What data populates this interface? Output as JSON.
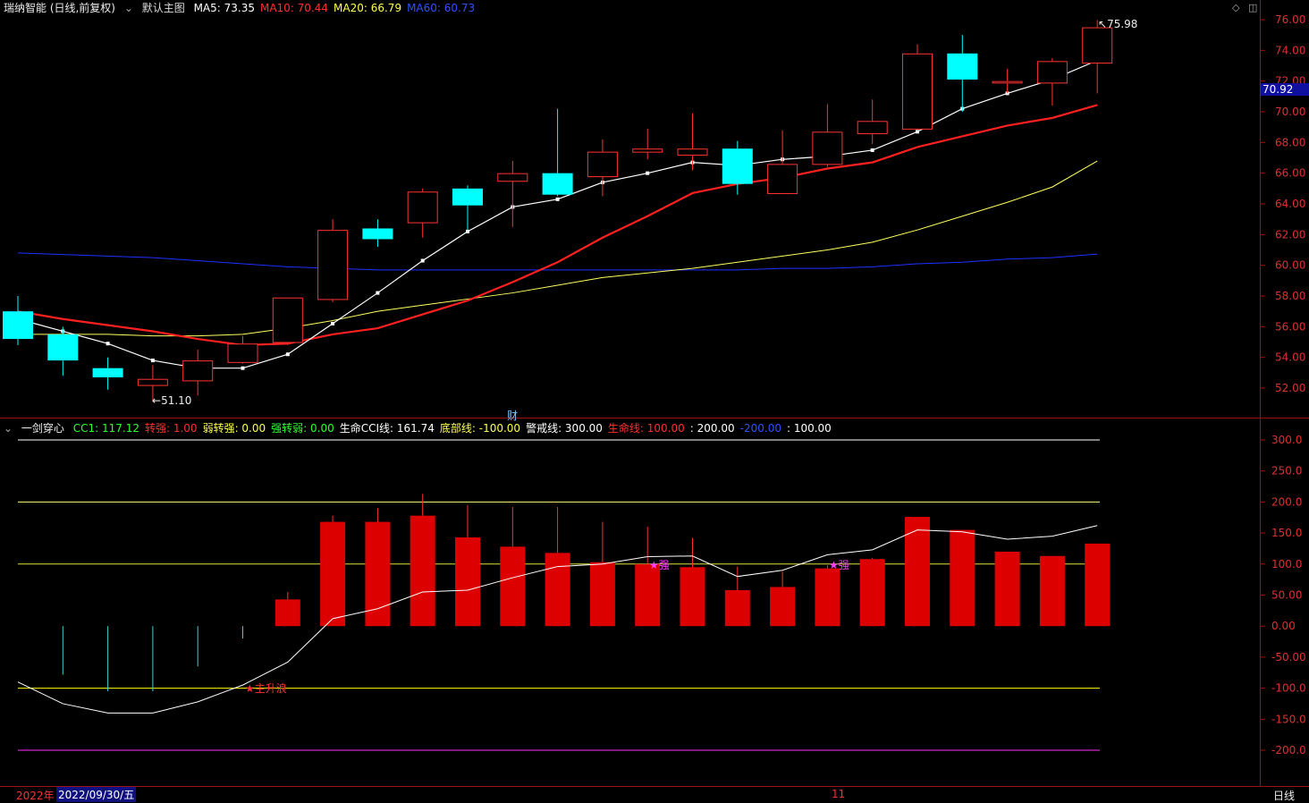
{
  "header": {
    "stock_name": "瑞纳智能 (日线,前复权)",
    "main_chart_label": "默认主图",
    "ma_labels": [
      {
        "text": "MA5: 73.35",
        "color": "#ffffff"
      },
      {
        "text": "MA10: 70.44",
        "color": "#ff3030"
      },
      {
        "text": "MA20: 66.79",
        "color": "#ffff50"
      },
      {
        "text": "MA60: 60.73",
        "color": "#3050ff"
      }
    ]
  },
  "indicator_header": {
    "name": "一剑穿心",
    "items": [
      {
        "text": "CC1: 117.12",
        "color": "#30ff30"
      },
      {
        "text": "转强: 1.00",
        "color": "#ff3030"
      },
      {
        "text": "弱转强: 0.00",
        "color": "#ffff50"
      },
      {
        "text": "强转弱: 0.00",
        "color": "#30ff30"
      },
      {
        "text": "生命CCI线: 161.74",
        "color": "#ffffff"
      },
      {
        "text": "底部线: -100.00",
        "color": "#ffff50"
      },
      {
        "text": "警戒线: 300.00",
        "color": "#ffffff"
      },
      {
        "text": "生命线: 100.00",
        "color": "#ff3030"
      },
      {
        "text": ": 200.00",
        "color": "#ffffff"
      },
      {
        "text": "-200.00",
        "color": "#3050ff"
      },
      {
        "text": ": 100.00",
        "color": "#ffffff"
      }
    ]
  },
  "current_price_label": "70.92",
  "markers": {
    "high": "75.98",
    "low": "51.10",
    "finance": "财",
    "signal_main": "主升浪",
    "signal_strong_1": "强",
    "signal_strong_2": "强"
  },
  "footer": {
    "year": "2022年",
    "date": "2022/09/30/五",
    "month": "11",
    "period": "日线"
  },
  "colors": {
    "up": "#ff3232",
    "down": "#00ffff",
    "ma5": "#ffffff",
    "ma10": "#ff2020",
    "ma20": "#ffff60",
    "ma60": "#2030ff",
    "bar": "#dd0000",
    "axis": "#a01010"
  },
  "chart_data": [
    {
      "type": "candlestick",
      "title": "瑞纳智能 (日线,前复权)",
      "ylim": [
        50.5,
        76.8
      ],
      "yticks": [
        52,
        54,
        56,
        58,
        60,
        62,
        64,
        66,
        68,
        70,
        72,
        74,
        76
      ],
      "ytick_labels": [
        "52.00",
        "54.00",
        "56.00",
        "58.00",
        "60.00",
        "62.00",
        "64.00",
        "66.00",
        "68.00",
        "70.00",
        "72.00",
        "74.00",
        "76.00"
      ],
      "candles": [
        {
          "o": 57.0,
          "h": 58.0,
          "l": 54.8,
          "c": 55.2
        },
        {
          "o": 55.5,
          "h": 56.0,
          "l": 52.8,
          "c": 53.8
        },
        {
          "o": 53.3,
          "h": 54.0,
          "l": 51.9,
          "c": 52.7
        },
        {
          "o": 52.2,
          "h": 53.5,
          "l": 51.1,
          "c": 52.6
        },
        {
          "o": 52.5,
          "h": 54.5,
          "l": 51.5,
          "c": 53.8
        },
        {
          "o": 53.7,
          "h": 55.4,
          "l": 53.6,
          "c": 54.9
        },
        {
          "o": 55.0,
          "h": 57.9,
          "l": 54.8,
          "c": 57.9
        },
        {
          "o": 57.8,
          "h": 63.0,
          "l": 57.6,
          "c": 62.3
        },
        {
          "o": 62.4,
          "h": 63.0,
          "l": 61.2,
          "c": 61.7
        },
        {
          "o": 62.8,
          "h": 65.0,
          "l": 61.8,
          "c": 64.8
        },
        {
          "o": 65.0,
          "h": 65.2,
          "l": 62.3,
          "c": 63.9
        },
        {
          "o": 65.5,
          "h": 66.8,
          "l": 62.5,
          "c": 66.0
        },
        {
          "o": 66.0,
          "h": 70.2,
          "l": 64.5,
          "c": 64.6
        },
        {
          "o": 65.8,
          "h": 68.2,
          "l": 64.5,
          "c": 67.4
        },
        {
          "o": 67.4,
          "h": 68.9,
          "l": 66.9,
          "c": 67.6
        },
        {
          "o": 67.2,
          "h": 69.9,
          "l": 66.2,
          "c": 67.6
        },
        {
          "o": 67.6,
          "h": 68.1,
          "l": 64.6,
          "c": 65.3
        },
        {
          "o": 64.7,
          "h": 68.8,
          "l": 64.7,
          "c": 66.6
        },
        {
          "o": 66.6,
          "h": 70.5,
          "l": 66.4,
          "c": 68.7
        },
        {
          "o": 68.6,
          "h": 70.8,
          "l": 67.9,
          "c": 69.4
        },
        {
          "o": 68.9,
          "h": 74.4,
          "l": 68.8,
          "c": 73.8
        },
        {
          "o": 73.8,
          "h": 75.0,
          "l": 70.0,
          "c": 72.1
        },
        {
          "o": 71.9,
          "h": 72.8,
          "l": 71.2,
          "c": 72.0
        },
        {
          "o": 71.9,
          "h": 73.5,
          "l": 70.4,
          "c": 73.3
        },
        {
          "o": 73.2,
          "h": 75.98,
          "l": 71.2,
          "c": 75.5
        }
      ],
      "ma5": [
        56.5,
        55.7,
        54.9,
        53.8,
        53.3,
        53.3,
        54.2,
        56.2,
        58.2,
        60.3,
        62.2,
        63.8,
        64.3,
        65.4,
        66.0,
        66.7,
        66.5,
        66.9,
        67.1,
        67.5,
        68.7,
        70.2,
        71.2,
        72.1,
        73.35
      ],
      "ma10": [
        57.0,
        56.5,
        56.1,
        55.7,
        55.2,
        54.8,
        54.9,
        55.5,
        55.9,
        56.8,
        57.7,
        58.9,
        60.2,
        61.8,
        63.2,
        64.7,
        65.3,
        65.7,
        66.3,
        66.7,
        67.7,
        68.4,
        69.1,
        69.6,
        70.44
      ],
      "ma20": [
        55.5,
        55.5,
        55.5,
        55.4,
        55.4,
        55.5,
        55.9,
        56.4,
        57.0,
        57.4,
        57.8,
        58.2,
        58.7,
        59.2,
        59.5,
        59.8,
        60.2,
        60.6,
        61.0,
        61.5,
        62.3,
        63.2,
        64.1,
        65.1,
        66.79
      ],
      "ma60": [
        60.8,
        60.7,
        60.6,
        60.5,
        60.3,
        60.1,
        59.9,
        59.8,
        59.7,
        59.7,
        59.7,
        59.7,
        59.7,
        59.7,
        59.7,
        59.7,
        59.7,
        59.8,
        59.8,
        59.9,
        60.1,
        60.2,
        60.4,
        60.5,
        60.73
      ]
    },
    {
      "type": "bar",
      "title": "一剑穿心",
      "ylim": [
        -225,
        330
      ],
      "yticks": [
        -200,
        -150,
        -100,
        -50,
        0,
        50,
        100,
        150,
        200,
        250,
        300
      ],
      "ytick_labels": [
        "-200.0",
        "-150.0",
        "-100.0",
        "-50.00",
        "0.00",
        "50.00",
        "100.0",
        "150.0",
        "200.0",
        "250.0",
        "300.0"
      ],
      "bars": [
        {
          "v": 0,
          "top": 0
        },
        {
          "v": -78,
          "top": 0
        },
        {
          "v": -105,
          "top": 0
        },
        {
          "v": -105,
          "top": 0
        },
        {
          "v": -65,
          "top": 0
        },
        {
          "v": -20,
          "top": 0
        },
        {
          "v": 43,
          "top": 55
        },
        {
          "v": 168,
          "top": 178
        },
        {
          "v": 168,
          "top": 190
        },
        {
          "v": 178,
          "top": 213
        },
        {
          "v": 143,
          "top": 195
        },
        {
          "v": 128,
          "top": 192
        },
        {
          "v": 118,
          "top": 192
        },
        {
          "v": 103,
          "top": 168
        },
        {
          "v": 100,
          "top": 160
        },
        {
          "v": 95,
          "top": 142
        },
        {
          "v": 58,
          "top": 96
        },
        {
          "v": 63,
          "top": 88
        },
        {
          "v": 93,
          "top": 98
        },
        {
          "v": 108,
          "top": 110
        },
        {
          "v": 176,
          "top": 176
        },
        {
          "v": 155,
          "top": 155
        },
        {
          "v": 120,
          "top": 120
        },
        {
          "v": 113,
          "top": 113
        },
        {
          "v": 133,
          "top": 133
        }
      ],
      "cci_line": [
        -90,
        -125,
        -140,
        -140,
        -122,
        -95,
        -58,
        12,
        28,
        55,
        58,
        78,
        96,
        100,
        112,
        113,
        80,
        90,
        115,
        123,
        155,
        152,
        140,
        145,
        162
      ],
      "hlines": [
        {
          "y": 300,
          "color": "#ffffff"
        },
        {
          "y": 200,
          "color": "#ffff80"
        },
        {
          "y": 100,
          "color": "#dddd40"
        },
        {
          "y": -100,
          "color": "#ffff00"
        },
        {
          "y": -200,
          "color": "#ff30ff"
        }
      ]
    }
  ]
}
